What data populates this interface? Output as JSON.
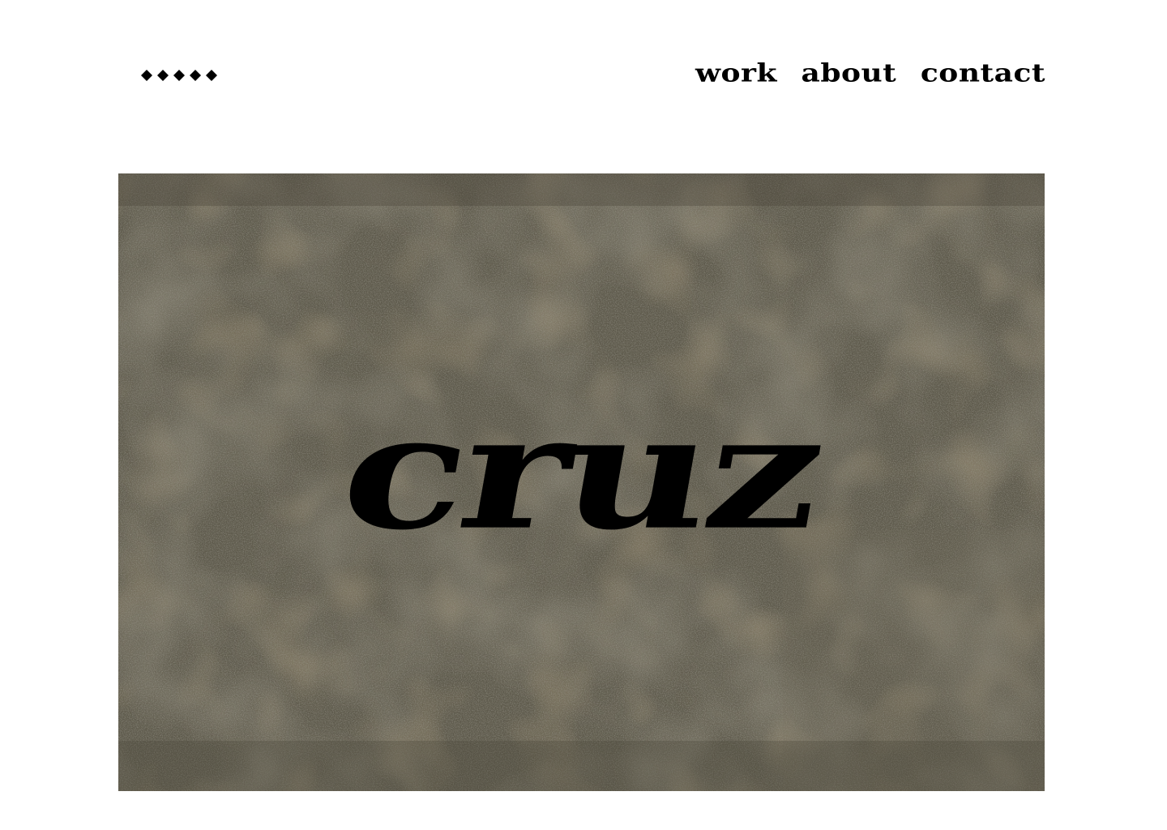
{
  "header": {
    "logo_glyphs": [
      "◆",
      "◆",
      "◆",
      "◆",
      "◆"
    ],
    "nav": [
      {
        "label": "work"
      },
      {
        "label": "about"
      },
      {
        "label": "contact"
      }
    ]
  },
  "hero": {
    "title": "cruz",
    "background": "stone-texture",
    "colors": {
      "base": "#5e5a4c",
      "dark": "#4a4638",
      "light": "#756f5f",
      "rust": "#6b5a3c",
      "text": "#000000"
    }
  }
}
